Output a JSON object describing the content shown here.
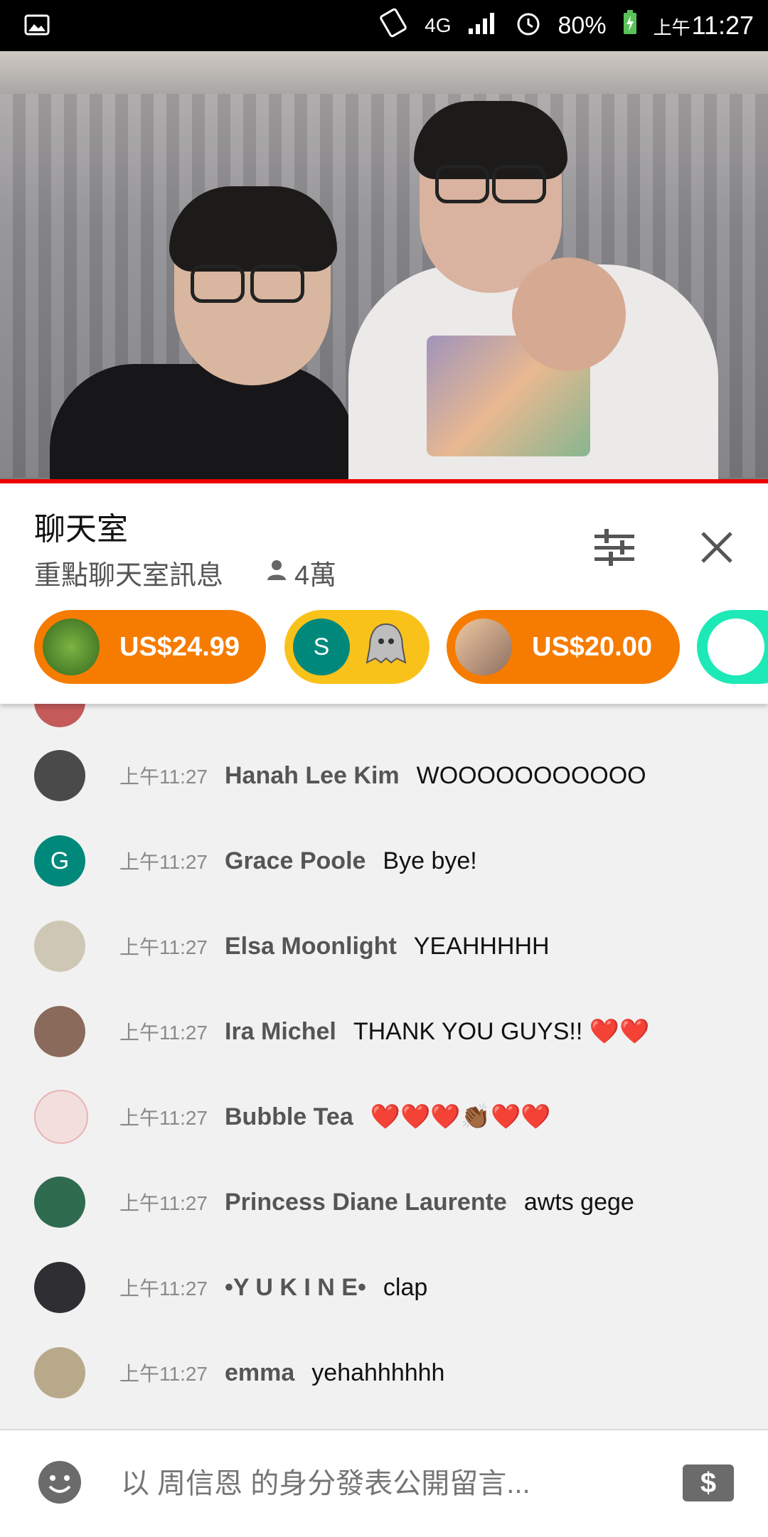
{
  "status_bar": {
    "battery": "80%",
    "time_prefix": "上午",
    "time": "11:27",
    "network": "4G"
  },
  "video": {
    "progress_color": "#e00000"
  },
  "chat": {
    "title": "聊天室",
    "subtitle": "重點聊天室訊息",
    "viewers": "4萬",
    "superchats": [
      {
        "amount": "US$24.99",
        "color": "#f57c00",
        "avatar": "leaf"
      },
      {
        "amount": "",
        "color": "#f9c21a",
        "avatar_letter": "S",
        "sticker": "ghost-sticker"
      },
      {
        "amount": "US$20.00",
        "color": "#f57c00",
        "avatar": "photo"
      },
      {
        "amount": "",
        "color": "#1de9b6",
        "avatar": "cartoon-girl"
      }
    ],
    "messages": [
      {
        "time": "上午11:27",
        "author": "Hanah Lee Kim",
        "text": "WOOOOOOOOOOO",
        "avatar_color": "#4a4a4a"
      },
      {
        "time": "上午11:27",
        "author": "Grace Poole",
        "text": "Bye bye!",
        "avatar_color": "#00897b",
        "avatar_letter": "G"
      },
      {
        "time": "上午11:27",
        "author": "Elsa Moonlight",
        "text": "YEAHHHHH",
        "avatar_color": "#cfc7b5"
      },
      {
        "time": "上午11:27",
        "author": "Ira Michel",
        "text": "THANK YOU GUYS!! ❤️❤️",
        "avatar_color": "#8a6a5a"
      },
      {
        "time": "上午11:27",
        "author": "Bubble Tea",
        "text": "❤️❤️❤️👏🏾❤️❤️",
        "avatar_color": "#f3dede"
      },
      {
        "time": "上午11:27",
        "author": "Princess Diane Laurente",
        "text": "awts gege",
        "avatar_color": "#2f6b4f"
      },
      {
        "time": "上午11:27",
        "author": "•Y U K I N E•",
        "text": "clap",
        "avatar_color": "#2f2f33"
      },
      {
        "time": "上午11:27",
        "author": "emma",
        "text": "yehahhhhhh",
        "avatar_color": "#b8a98a"
      }
    ]
  },
  "input": {
    "placeholder": "以 周信恩 的身分發表公開留言..."
  }
}
